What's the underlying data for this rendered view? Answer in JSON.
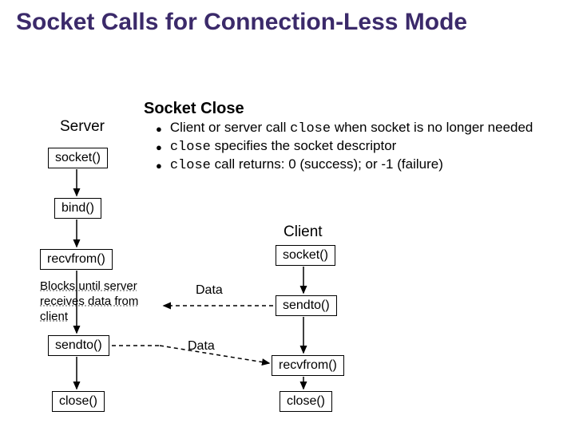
{
  "title": "Socket Calls for Connection-Less Mode",
  "sub": "Socket Close",
  "bullets": {
    "b1a": "Client or server call ",
    "b1code": "close",
    "b1b": " when socket is no longer needed",
    "b2code": "close",
    "b2b": " specifies the socket descriptor",
    "b3code": "close",
    "b3b": " call returns: 0 (success); or -1 (failure)"
  },
  "labels": {
    "server": "Server",
    "client": "Client",
    "data1": "Data",
    "data2": "Data",
    "note": "Blocks until server receives data from client"
  },
  "server_boxes": {
    "socket": "socket()",
    "bind": "bind()",
    "recvfrom": "recvfrom()",
    "sendto": "sendto()",
    "close": "close()"
  },
  "client_boxes": {
    "socket": "socket()",
    "sendto": "sendto()",
    "recvfrom": "recvfrom()",
    "close": "close()"
  }
}
